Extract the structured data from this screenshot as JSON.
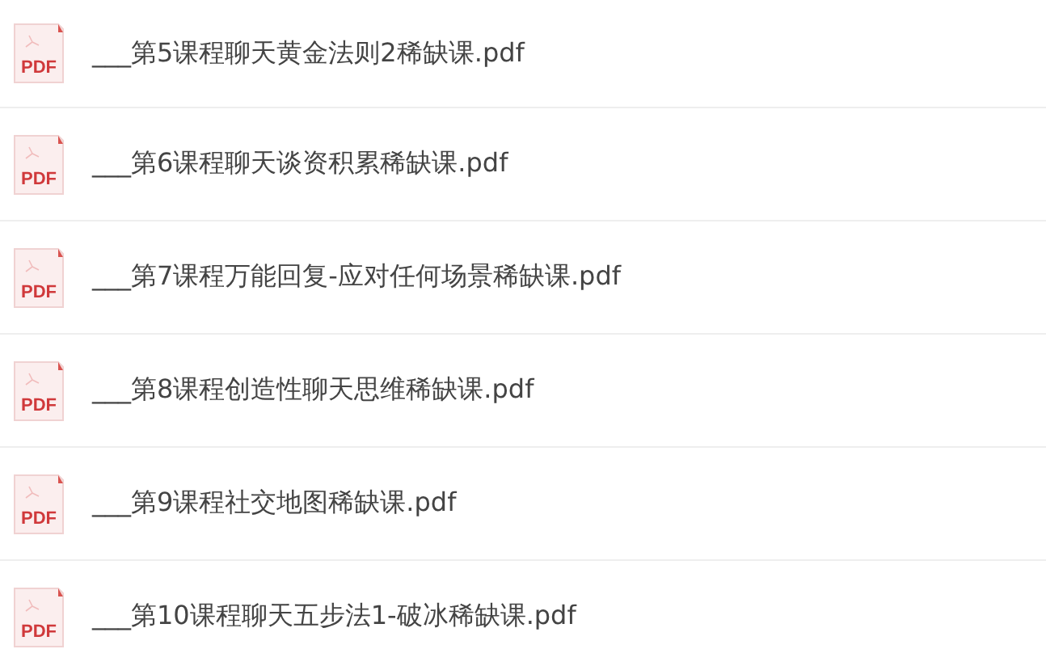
{
  "files": [
    {
      "icon_label": "PDF",
      "name": "___第5课程聊天黄金法则2稀缺课.pdf"
    },
    {
      "icon_label": "PDF",
      "name": "___第6课程聊天谈资积累稀缺课.pdf"
    },
    {
      "icon_label": "PDF",
      "name": "___第7课程万能回复-应对任何场景稀缺课.pdf"
    },
    {
      "icon_label": "PDF",
      "name": "___第8课程创造性聊天思维稀缺课.pdf"
    },
    {
      "icon_label": "PDF",
      "name": "___第9课程社交地图稀缺课.pdf"
    },
    {
      "icon_label": "PDF",
      "name": "___第10课程聊天五步法1-破冰稀缺课.pdf"
    }
  ]
}
